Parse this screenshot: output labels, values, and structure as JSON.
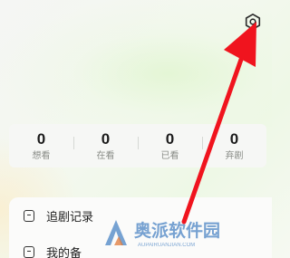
{
  "header": {
    "settings_icon": "settings-hexagon-icon"
  },
  "stats": [
    {
      "value": "0",
      "label": "想看"
    },
    {
      "value": "0",
      "label": "在看"
    },
    {
      "value": "0",
      "label": "已看"
    },
    {
      "value": "0",
      "label": "弃剧"
    }
  ],
  "menu": [
    {
      "label": "追剧记录",
      "icon": "document-icon"
    },
    {
      "label": "我的备",
      "icon": "document-icon"
    }
  ],
  "annotation": {
    "arrow_color": "#f0141e"
  },
  "watermark": {
    "brand": "奥派软件园",
    "url": "AUPAIRUANJIAN.COM"
  }
}
